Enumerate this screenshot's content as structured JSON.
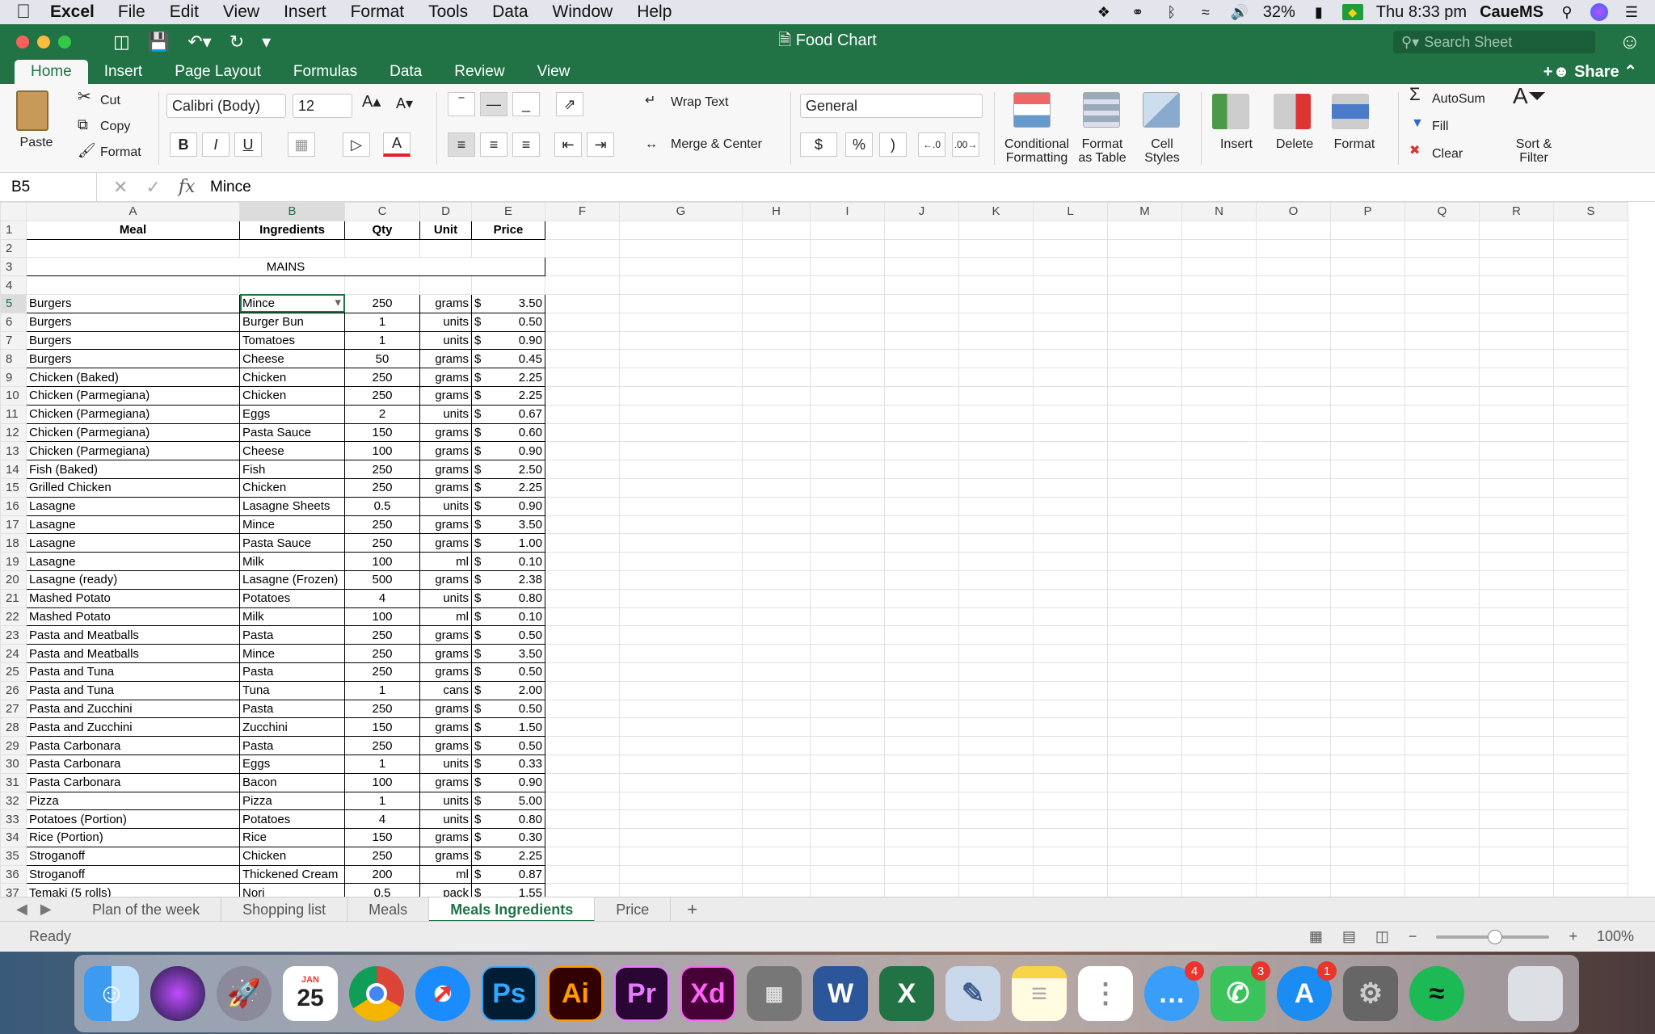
{
  "menubar": {
    "app_name": "Excel",
    "items": [
      "File",
      "Edit",
      "View",
      "Insert",
      "Format",
      "Tools",
      "Data",
      "Window",
      "Help"
    ],
    "battery": "32%",
    "clock": "Thu 8:33 pm",
    "user": "CaueMS"
  },
  "window": {
    "title": "Food Chart",
    "search_placeholder": "Search Sheet"
  },
  "ribbon_tabs": [
    "Home",
    "Insert",
    "Page Layout",
    "Formulas",
    "Data",
    "Review",
    "View"
  ],
  "active_tab": "Home",
  "share_label": "Share",
  "ribbon": {
    "paste": "Paste",
    "cut": "Cut",
    "copy": "Copy",
    "format_painter": "Format",
    "font_name": "Calibri (Body)",
    "font_size": "12",
    "bold": "B",
    "italic": "I",
    "underline": "U",
    "wrap_text": "Wrap Text",
    "merge_center": "Merge & Center",
    "number_format": "General",
    "currency": "$",
    "percent": "%",
    "comma": ")",
    "conditional_formatting_1": "Conditional",
    "conditional_formatting_2": "Formatting",
    "format_as_table_1": "Format",
    "format_as_table_2": "as Table",
    "cell_styles_1": "Cell",
    "cell_styles_2": "Styles",
    "insert": "Insert",
    "delete": "Delete",
    "format": "Format",
    "autosum": "AutoSum",
    "fill": "Fill",
    "clear": "Clear",
    "sort_filter_1": "Sort &",
    "sort_filter_2": "Filter"
  },
  "formula_bar": {
    "name_box": "B5",
    "fx": "fx",
    "content": "Mince"
  },
  "columns": [
    "A",
    "B",
    "C",
    "D",
    "E",
    "F",
    "G",
    "H",
    "I",
    "J",
    "K",
    "L",
    "M",
    "N",
    "O",
    "P",
    "Q",
    "R",
    "S"
  ],
  "header_row": [
    "Meal",
    "Ingredients",
    "Qty",
    "Unit",
    "Price"
  ],
  "section_label": "MAINS",
  "currency_symbol": "$",
  "rows": [
    [
      "Burgers",
      "Mince",
      "250",
      "grams",
      "3.50"
    ],
    [
      "Burgers",
      "Burger Bun",
      "1",
      "units",
      "0.50"
    ],
    [
      "Burgers",
      "Tomatoes",
      "1",
      "units",
      "0.90"
    ],
    [
      "Burgers",
      "Cheese",
      "50",
      "grams",
      "0.45"
    ],
    [
      "Chicken (Baked)",
      "Chicken",
      "250",
      "grams",
      "2.25"
    ],
    [
      "Chicken (Parmegiana)",
      "Chicken",
      "250",
      "grams",
      "2.25"
    ],
    [
      "Chicken (Parmegiana)",
      "Eggs",
      "2",
      "units",
      "0.67"
    ],
    [
      "Chicken (Parmegiana)",
      "Pasta Sauce",
      "150",
      "grams",
      "0.60"
    ],
    [
      "Chicken (Parmegiana)",
      "Cheese",
      "100",
      "grams",
      "0.90"
    ],
    [
      "Fish (Baked)",
      "Fish",
      "250",
      "grams",
      "2.50"
    ],
    [
      "Grilled Chicken",
      "Chicken",
      "250",
      "grams",
      "2.25"
    ],
    [
      "Lasagne",
      "Lasagne Sheets",
      "0.5",
      "units",
      "0.90"
    ],
    [
      "Lasagne",
      "Mince",
      "250",
      "grams",
      "3.50"
    ],
    [
      "Lasagne",
      "Pasta Sauce",
      "250",
      "grams",
      "1.00"
    ],
    [
      "Lasagne",
      "Milk",
      "100",
      "ml",
      "0.10"
    ],
    [
      "Lasagne (ready)",
      "Lasagne (Frozen)",
      "500",
      "grams",
      "2.38"
    ],
    [
      "Mashed Potato",
      "Potatoes",
      "4",
      "units",
      "0.80"
    ],
    [
      "Mashed Potato",
      "Milk",
      "100",
      "ml",
      "0.10"
    ],
    [
      "Pasta and Meatballs",
      "Pasta",
      "250",
      "grams",
      "0.50"
    ],
    [
      "Pasta and Meatballs",
      "Mince",
      "250",
      "grams",
      "3.50"
    ],
    [
      "Pasta and Tuna",
      "Pasta",
      "250",
      "grams",
      "0.50"
    ],
    [
      "Pasta and Tuna",
      "Tuna",
      "1",
      "cans",
      "2.00"
    ],
    [
      "Pasta and Zucchini",
      "Pasta",
      "250",
      "grams",
      "0.50"
    ],
    [
      "Pasta and Zucchini",
      "Zucchini",
      "150",
      "grams",
      "1.50"
    ],
    [
      "Pasta Carbonara",
      "Pasta",
      "250",
      "grams",
      "0.50"
    ],
    [
      "Pasta Carbonara",
      "Eggs",
      "1",
      "units",
      "0.33"
    ],
    [
      "Pasta Carbonara",
      "Bacon",
      "100",
      "grams",
      "0.90"
    ],
    [
      "Pizza",
      "Pizza",
      "1",
      "units",
      "5.00"
    ],
    [
      "Potatoes (Portion)",
      "Potatoes",
      "4",
      "units",
      "0.80"
    ],
    [
      "Rice (Portion)",
      "Rice",
      "150",
      "grams",
      "0.30"
    ],
    [
      "Stroganoff",
      "Chicken",
      "250",
      "grams",
      "2.25"
    ],
    [
      "Stroganoff",
      "Thickened Cream",
      "200",
      "ml",
      "0.87"
    ],
    [
      "Temaki (5 rolls)",
      "Nori",
      "0.5",
      "pack",
      "1.55"
    ]
  ],
  "sheet_tabs": [
    "Plan of the week",
    "Shopping list",
    "Meals",
    "Meals Ingredients",
    "Price"
  ],
  "active_sheet": "Meals Ingredients",
  "status": {
    "ready": "Ready",
    "zoom": "100%"
  },
  "dock": {
    "calendar_month": "JAN",
    "calendar_day": "25",
    "messages_badge": "4",
    "facetime_badge": "3",
    "appstore_badge": "1",
    "ps_label": "Ps",
    "ai_label": "Ai",
    "pr_label": "Pr",
    "xd_label": "Xd"
  }
}
